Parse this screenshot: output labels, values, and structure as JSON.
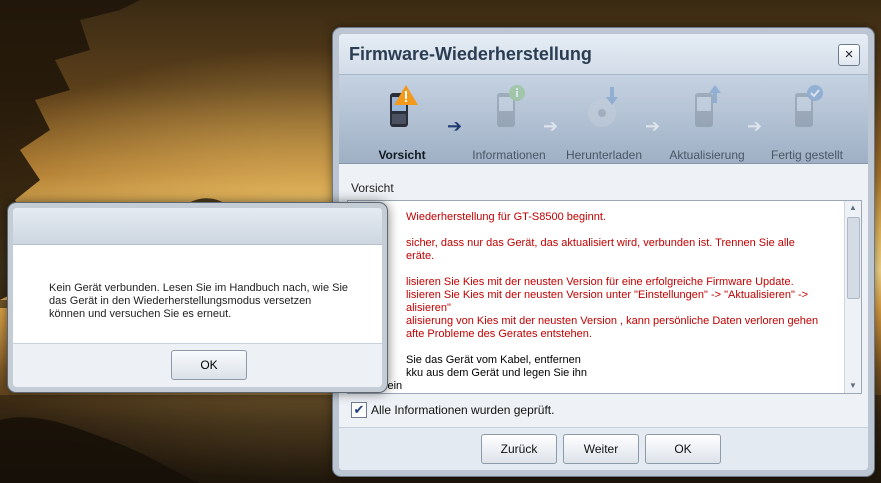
{
  "dialog": {
    "title": "Firmware-Wiederherstellung",
    "close_symbol": "×",
    "steps": [
      {
        "label": "Vorsicht",
        "icon": "phone-warning-icon"
      },
      {
        "label": "Informationen",
        "icon": "phone-info-icon"
      },
      {
        "label": "Herunterladen",
        "icon": "disc-download-icon"
      },
      {
        "label": "Aktualisierung",
        "icon": "phone-update-icon"
      },
      {
        "label": "Fertig gestellt",
        "icon": "phone-check-icon"
      }
    ],
    "section_label": "Vorsicht",
    "info_lines": [
      "Wiederherstellung für GT-S8500 beginnt.",
      "sicher, dass nur das Gerät, das aktualisiert wird, verbunden ist. Trennen Sie alle",
      "eräte.",
      "lisieren Sie Kies mit der neusten Version für eine erfolgreiche Firmware Update.",
      "lisieren Sie Kies mit der neusten Version unter   \"Einstellungen\" -> \"Aktualisieren\" ->",
      "alisieren\"",
      "alisierung von Kies mit der neusten Version , kann persönliche Daten verloren gehen",
      "afte Probleme des Gerates entstehen.",
      "Sie das Gerät vom Kabel, entfernen",
      "kku aus dem Gerät und legen Sie ihn",
      "wieder ein"
    ],
    "checkbox": {
      "label": "Alle Informationen wurden geprüft.",
      "checked": true,
      "mark": "✔"
    },
    "buttons": {
      "back": "Zurück",
      "next": "Weiter",
      "ok": "OK"
    }
  },
  "alert": {
    "message": "Kein Gerät verbunden. Lesen Sie im Handbuch nach, wie Sie das Gerät in den Wiederherstellungsmodus versetzen können und versuchen Sie es erneut.",
    "ok_label": "OK"
  },
  "colors": {
    "warning_text": "#c00000",
    "title_text": "#2b3d52",
    "active_arrow": "#1f3b6f"
  }
}
